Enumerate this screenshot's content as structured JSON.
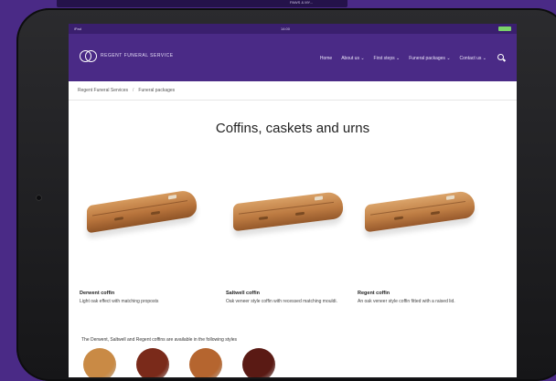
{
  "backdrop": {
    "top_strip_text": "PAWS & MY..."
  },
  "status_bar": {
    "carrier": "iPad",
    "time": "14:00"
  },
  "header": {
    "logo_text": "REGENT FUNERAL SERVICE",
    "nav": [
      {
        "label": "Home"
      },
      {
        "label": "About us ⌄"
      },
      {
        "label": "First steps ⌄"
      },
      {
        "label": "Funeral packages ⌄"
      },
      {
        "label": "Contact us ⌄"
      }
    ]
  },
  "breadcrumb": {
    "items": [
      "Regent Funeral Services",
      "Funeral packages"
    ],
    "separator": "/"
  },
  "page": {
    "title": "Coffins, caskets and urns"
  },
  "products": [
    {
      "name": "Derwent coffin",
      "description": "Light oak effect with matching proposts"
    },
    {
      "name": "Saltwell coffin",
      "description": "Oak veneer style coffin with recessed matching mouldi."
    },
    {
      "name": "Regent coffin",
      "description": "An oak veneer style coffin fitted with a raised lid."
    }
  ],
  "styles_caption": "The Derwent, Saltwell and Regent coffins are available in the following styles",
  "swatches": [
    {
      "color": "#c98a45"
    },
    {
      "color": "#7a2a1a"
    },
    {
      "color": "#b5652f"
    },
    {
      "color": "#5a1a14"
    }
  ],
  "colors": {
    "brand_purple": "#4a2a86",
    "wood_light": "#d69a5d",
    "wood_dark": "#8f5427"
  }
}
